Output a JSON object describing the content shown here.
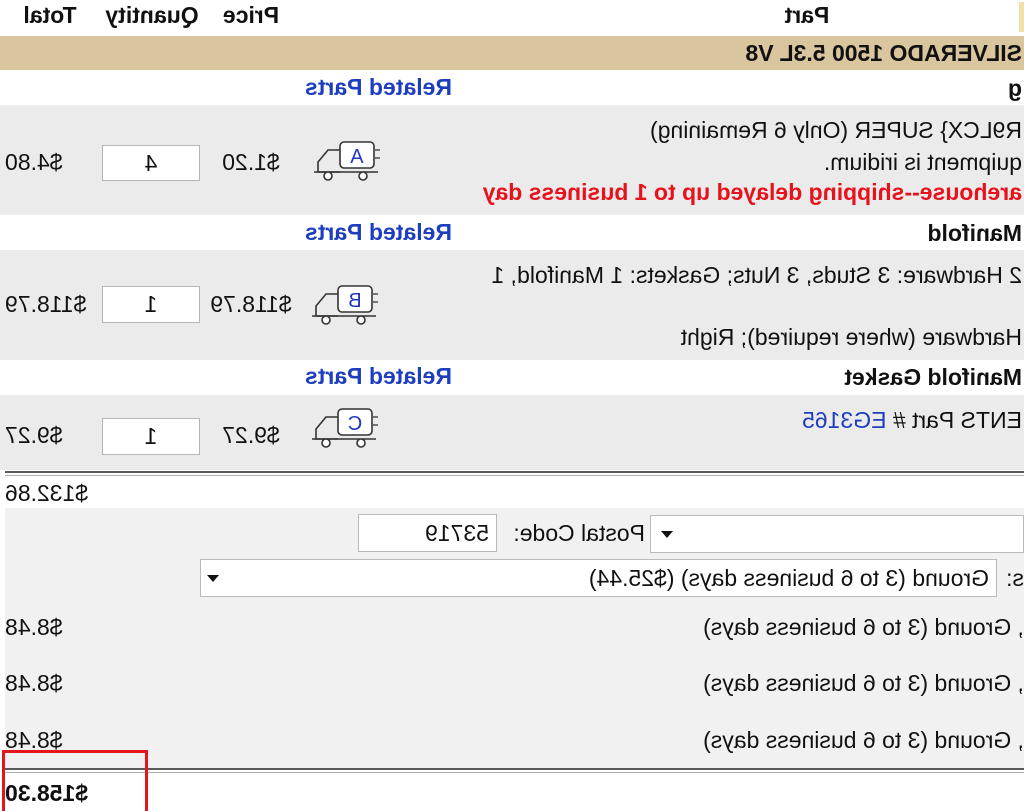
{
  "header": {
    "part": "Part",
    "price": "Price",
    "quantity": "Quantity",
    "total": "Total"
  },
  "cart": {
    "vehicle": "SILVERADO 1500 5.3L V8",
    "groups": [
      {
        "category": "g",
        "related_link": "Related Parts",
        "item": {
          "description": [
            "R9LCX} SUPER (Only 6 Remaining)",
            "quipment is iridium."
          ],
          "warning": "arehouse--shipping delayed up to 1 business day",
          "ship_badge": "A",
          "price": "$1.20",
          "quantity": "4",
          "total": "$4.80"
        }
      },
      {
        "category": "Manifold",
        "related_link": "Related Parts",
        "item": {
          "description": [
            "2 Hardware: 3 Studs, 3 Nuts; Gaskets: 1 Manifold, 1",
            "Hardware (where required); Right"
          ],
          "ship_badge": "B",
          "price": "$118.79",
          "quantity": "1",
          "total": "$118.79"
        }
      },
      {
        "category": "Manifold Gasket",
        "related_link": "Related Parts",
        "item": {
          "part_number_label": "ENTS Part #",
          "part_number": "EG3165",
          "ship_badge": "C",
          "price": "$9.27",
          "quantity": "1",
          "total": "$9.27"
        }
      }
    ],
    "subtotal": "$132.86",
    "shipping": {
      "postal_label": "Postal Code:",
      "postal_code": "53719",
      "options_label": "s:",
      "selected_option": "Ground (3 to 6 business days) ($25.44)",
      "lines": [
        {
          "label": ", Ground (3 to 6 business days)",
          "amount": "$8.48"
        },
        {
          "label": ", Ground (3 to 6 business days)",
          "amount": "$8.48"
        },
        {
          "label": ", Ground (3 to 6 business days)",
          "amount": "$8.48"
        }
      ]
    },
    "grand_total": "$158.30"
  },
  "colors": {
    "band": "#d9c69f",
    "row": "#ebebeb",
    "panel": "#f1f1f1",
    "link": "#1e3ebf",
    "warning": "#e8121c",
    "highlight": "#e3161c"
  },
  "icons": {
    "shipping": "delivery-truck-icon",
    "dropdown": "chevron-down-icon"
  }
}
